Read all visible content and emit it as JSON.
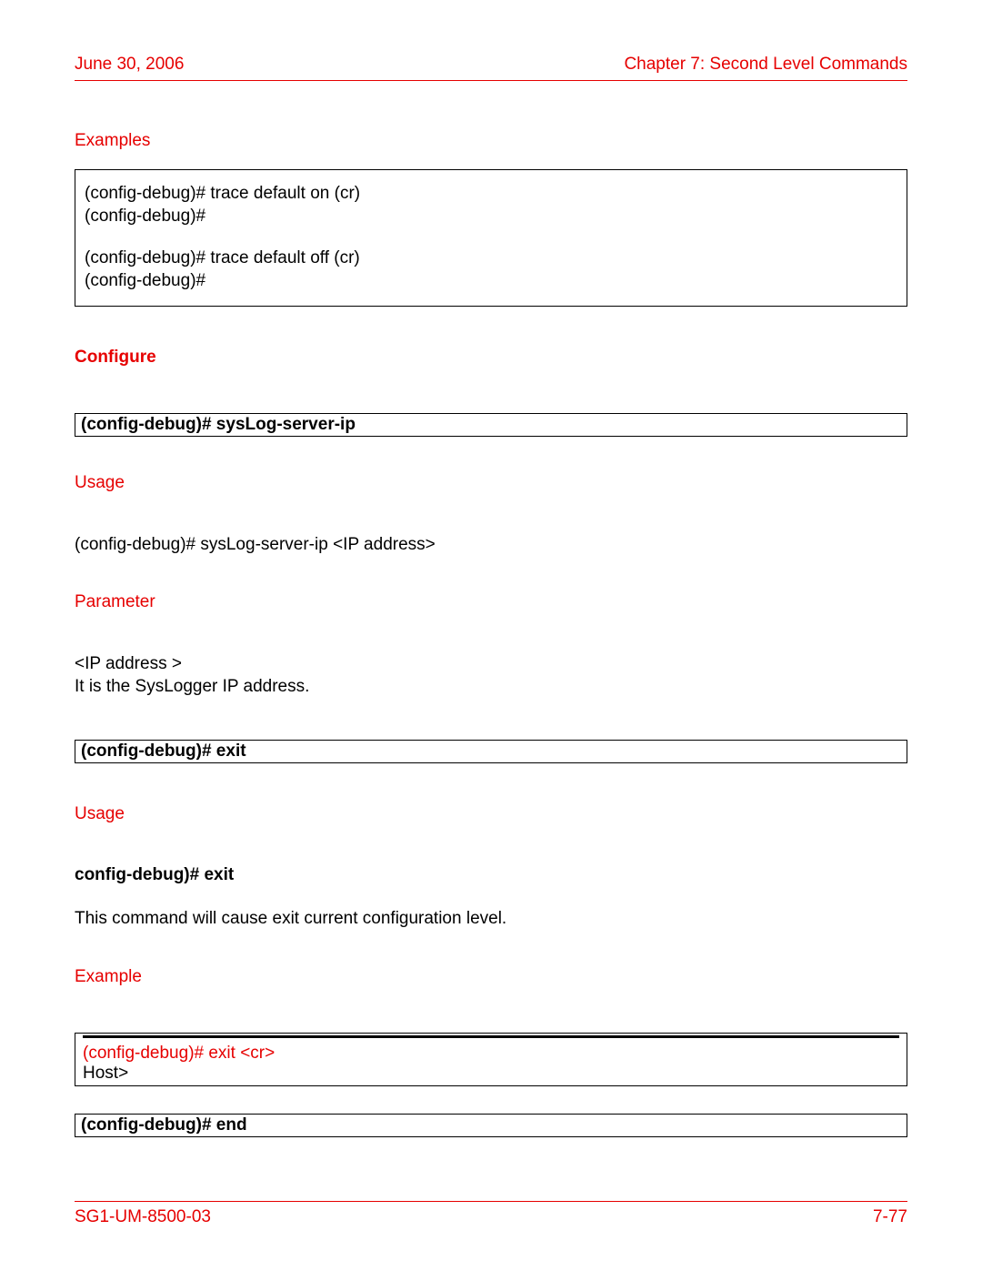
{
  "header": {
    "date": "June 30, 2006",
    "chapter": "Chapter 7: Second Level Commands"
  },
  "sec_examples": {
    "heading": "Examples",
    "line1": "(config-debug)# trace default on (cr)",
    "line2": "(config-debug)#",
    "line3": "(config-debug)# trace default off (cr)",
    "line4": "(config-debug)#"
  },
  "configure_heading": "Configure",
  "cmd_syslog": "(config-debug)# sysLog-server-ip",
  "syslog": {
    "usage_heading": "Usage",
    "usage_text": "(config-debug)# sysLog-server-ip <IP address>",
    "param_heading": "Parameter",
    "param_line1": "<IP address >",
    "param_line2": "It is the SysLogger IP address."
  },
  "cmd_exit": "(config-debug)# exit",
  "exit": {
    "usage_heading": "Usage",
    "usage_cmd": "config-debug)# exit",
    "usage_desc": "This command will cause exit current configuration level.",
    "example_heading": "Example",
    "ex_line1": "(config-debug)# exit  <cr>",
    "ex_line2": "Host>"
  },
  "cmd_end": "(config-debug)# end",
  "footer": {
    "doc_id": "SG1-UM-8500-03",
    "page": "7-77"
  }
}
